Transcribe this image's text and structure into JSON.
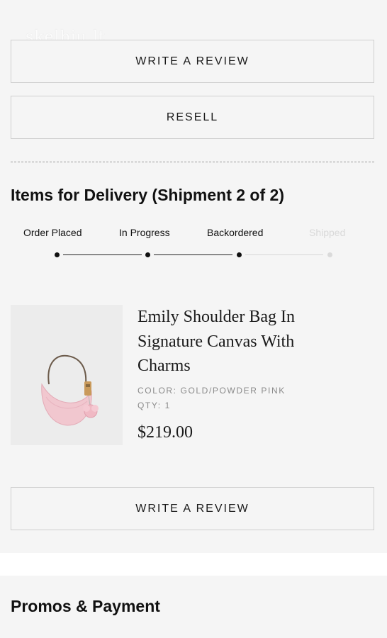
{
  "watermark": "skelbiu.lt",
  "actions": {
    "write_review_top": "WRITE A REVIEW",
    "resell": "RESELL",
    "write_review_bottom": "WRITE A REVIEW"
  },
  "shipment": {
    "title": "Items for Delivery (Shipment 2 of 2)",
    "steps": [
      {
        "label": "Order Placed",
        "status": "done"
      },
      {
        "label": "In Progress",
        "status": "done"
      },
      {
        "label": "Backordered",
        "status": "current"
      },
      {
        "label": "Shipped",
        "status": "pending"
      }
    ]
  },
  "item": {
    "title": "Emily Shoulder Bag In Signature Canvas With Charms",
    "color_label": "COLOR: GOLD/POWDER PINK",
    "qty_label": "QTY: 1",
    "price": "$219.00",
    "image_icon": "handbag-icon"
  },
  "promos": {
    "title": "Promos & Payment"
  },
  "colors": {
    "panel_bg": "#f5f5f5",
    "text": "#111111",
    "muted": "#d9d9d9",
    "meta": "#8a8a8a"
  }
}
